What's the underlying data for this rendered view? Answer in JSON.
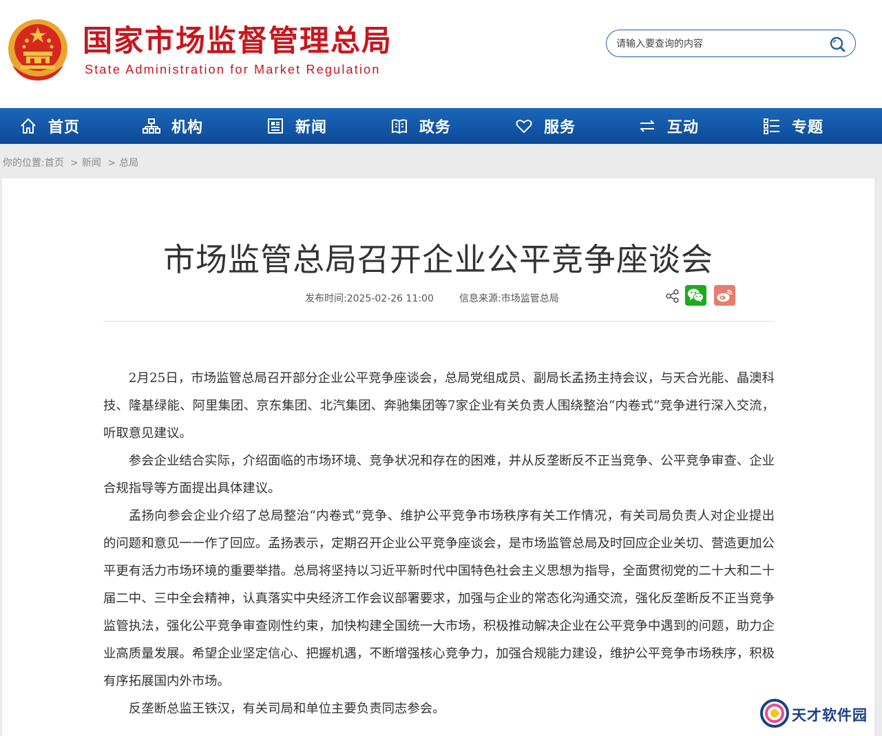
{
  "header": {
    "logo_cn": "国家市场监督管理总局",
    "logo_en": "State Administration for Market Regulation",
    "search_placeholder": "请输入要查询的内容"
  },
  "nav": {
    "items": [
      {
        "label": "首页",
        "icon": "home-icon"
      },
      {
        "label": "机构",
        "icon": "org-chart-icon"
      },
      {
        "label": "新闻",
        "icon": "news-icon"
      },
      {
        "label": "政务",
        "icon": "government-affairs-icon"
      },
      {
        "label": "服务",
        "icon": "heart-icon"
      },
      {
        "label": "互动",
        "icon": "exchange-arrows-icon"
      },
      {
        "label": "专题",
        "icon": "topics-list-icon"
      }
    ]
  },
  "breadcrumb": {
    "prefix": "你的位置:",
    "items": [
      "首页",
      "新闻",
      "总局"
    ],
    "separator": ">"
  },
  "article": {
    "title": "市场监管总局召开企业公平竞争座谈会",
    "publish_time_label": "发布时间:",
    "publish_time": "2025-02-26 11:00",
    "source_label": "信息来源:",
    "source": "市场监管总局",
    "paragraphs": [
      "2月25日，市场监管总局召开部分企业公平竞争座谈会，总局党组成员、副局长孟扬主持会议，与天合光能、晶澳科技、隆基绿能、阿里集团、京东集团、北汽集团、奔驰集团等7家企业有关负责人围绕整治“内卷式”竞争进行深入交流，听取意见建议。",
      "参会企业结合实际，介绍面临的市场环境、竞争状况和存在的困难，并从反垄断反不正当竞争、公平竞争审查、企业合规指导等方面提出具体建议。",
      "孟扬向参会企业介绍了总局整治“内卷式”竞争、维护公平竞争市场秩序有关工作情况，有关司局负责人对企业提出的问题和意见一一作了回应。孟扬表示，定期召开企业公平竞争座谈会，是市场监管总局及时回应企业关切、营造更加公平更有活力市场环境的重要举措。总局将坚持以习近平新时代中国特色社会主义思想为指导，全面贯彻党的二十大和二十届二中、三中全会精神，认真落实中央经济工作会议部署要求，加强与企业的常态化沟通交流，强化反垄断反不正当竞争监管执法，强化公平竞争审查刚性约束，加快构建全国统一大市场，积极推动解决企业在公平竞争中遇到的问题，助力企业高质量发展。希望企业坚定信心、把握机遇，不断增强核心竞争力，加强合规能力建设，维护公平竞争市场秩序，积极有序拓展国内外市场。",
      "反垄断总监王铁汉，有关司局和单位主要负责同志参会。"
    ]
  },
  "watermark": {
    "text": "天才软件园"
  },
  "colors": {
    "brand_red": "#c8161d",
    "nav_blue": "#1b66b8",
    "wechat_green": "#1aad19",
    "weibo_red": "#e87c6e"
  }
}
